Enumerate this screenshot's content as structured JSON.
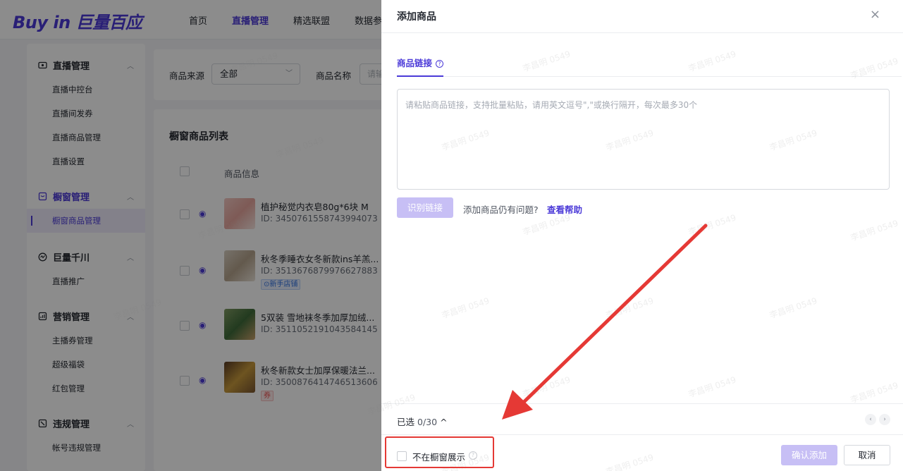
{
  "header": {
    "logo": "Buy in 巨量百应",
    "nav": [
      "首页",
      "直播管理",
      "精选联盟",
      "数据参"
    ],
    "active_nav": 1
  },
  "sidebar": {
    "groups": [
      {
        "label": "直播管理",
        "icon": "live-icon",
        "items": [
          "直播中控台",
          "直播间发券",
          "直播商品管理",
          "直播设置"
        ]
      },
      {
        "label": "橱窗管理",
        "icon": "window-icon",
        "items": [
          "橱窗商品管理"
        ],
        "active_item": 0
      },
      {
        "label": "巨量千川",
        "icon": "qianchuan-icon",
        "items": [
          "直播推广"
        ]
      },
      {
        "label": "营销管理",
        "icon": "marketing-icon",
        "items": [
          "主播券管理",
          "超级福袋",
          "红包管理"
        ]
      },
      {
        "label": "违规管理",
        "icon": "violation-icon",
        "items": [
          "帐号违规管理"
        ]
      }
    ]
  },
  "filters": {
    "source_label": "商品来源",
    "source_value": "全部",
    "name_label": "商品名称",
    "name_placeholder": "请输"
  },
  "product_list": {
    "title": "橱窗商品列表",
    "column_header": "商品信息",
    "rows": [
      {
        "name": "植护秘觉内衣皂80g*6块 M",
        "id": "ID: 3450761558743994073",
        "tag": ""
      },
      {
        "name": "秋冬季睡衣女冬新款ins羊羔...",
        "id": "ID: 3513676879976627883",
        "tag": "⊙新手店铺"
      },
      {
        "name": "5双装 雪地袜冬季加厚加绒...",
        "id": "ID: 3511052191043584145",
        "tag": ""
      },
      {
        "name": "秋冬新款女士加厚保暖法兰...",
        "id": "ID: 3500876414746513606",
        "tag": "券"
      }
    ]
  },
  "drawer": {
    "title": "添加商品",
    "close": "×",
    "tab": "商品链接",
    "tab_help": "?",
    "textarea_placeholder": "请粘贴商品链接，支持批量粘贴，请用英文逗号\",\"或换行隔开，每次最多30个",
    "parse_button": "识别链接",
    "help_question": "添加商品仍有问题?",
    "help_link": "查看帮助",
    "selected_label": "已选",
    "selected_count": "0/30",
    "selected_toggle": "^",
    "prev": "‹",
    "next": "›",
    "hide_option": "不在橱窗展示",
    "hide_info": "?",
    "confirm_button": "确认添加",
    "cancel_button": "取消"
  },
  "watermark": "李昌明 0549",
  "colors": {
    "brand": "#4b3ad8",
    "annotation": "#e53935"
  }
}
